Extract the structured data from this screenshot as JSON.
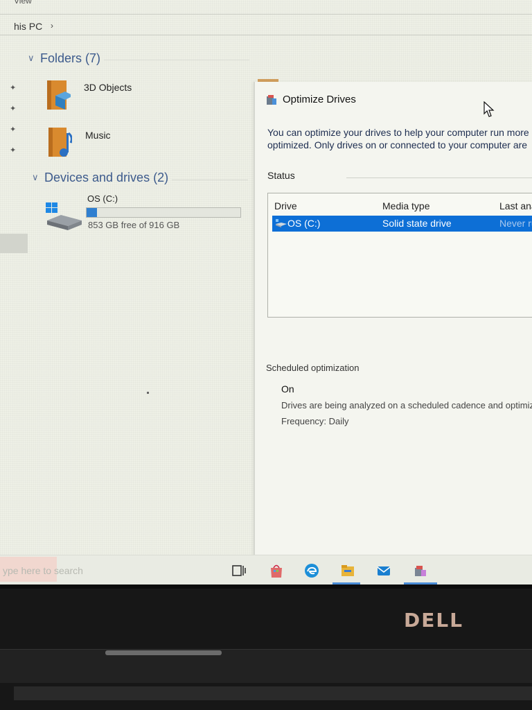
{
  "explorer": {
    "view_menu": "View",
    "breadcrumb": "his PC",
    "breadcrumb_chevron": "›",
    "folders_header": "Folders (7)",
    "folders": [
      {
        "label": "3D Objects",
        "icon": "3d-objects-folder-icon"
      },
      {
        "label": "Music",
        "icon": "music-folder-icon"
      }
    ],
    "devices_header": "Devices and drives (2)",
    "drive": {
      "name": "OS (C:)",
      "free_text": "853 GB free of 916 GB",
      "used_fraction": 0.069
    }
  },
  "dialog": {
    "title": "Optimize Drives",
    "description_line1": "You can optimize your drives to help your computer run more",
    "description_line2": "optimized. Only drives on or connected to your computer are",
    "status_label": "Status",
    "columns": [
      "Drive",
      "Media type",
      "Last ana"
    ],
    "rows": [
      {
        "drive": "OS (C:)",
        "media_type": "Solid state drive",
        "last_analyzed": "Never ru"
      }
    ],
    "scheduled_label": "Scheduled optimization",
    "scheduled_state": "On",
    "scheduled_desc": "Drives are being analyzed on a scheduled cadence and optimiz",
    "frequency": "Frequency: Daily"
  },
  "taskbar": {
    "search_placeholder": "ype here to search",
    "icons": [
      "task-view-icon",
      "store-icon",
      "edge-icon",
      "file-explorer-icon",
      "mail-icon",
      "defrag-icon"
    ]
  },
  "bezel": {
    "brand": "DELL"
  },
  "colors": {
    "accent": "#0d6fd6",
    "drive_bar": "#2f7fd0",
    "folder": "#d98a2e",
    "brand_logo": "#c8a998"
  }
}
